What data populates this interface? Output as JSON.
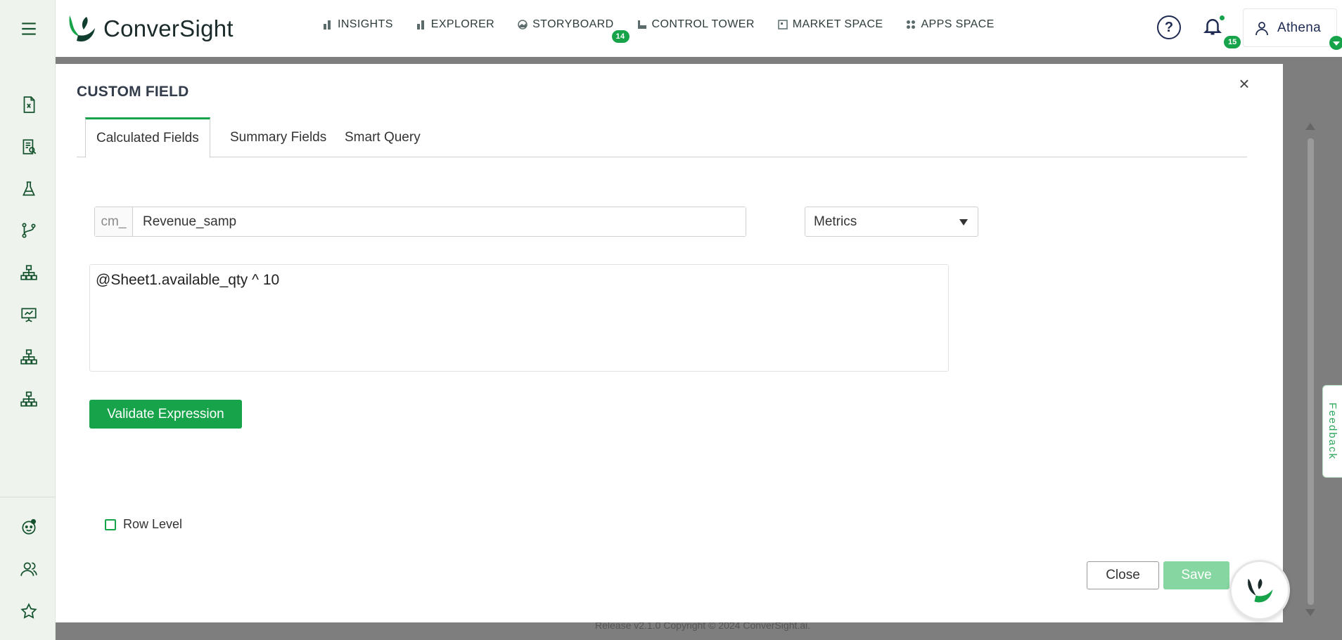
{
  "app": {
    "logo_text": "ConverSight"
  },
  "nav": {
    "items": [
      {
        "label": "INSIGHTS",
        "icon": "bar-chart-icon"
      },
      {
        "label": "EXPLORER",
        "icon": "bar-chart-icon"
      },
      {
        "label": "STORYBOARD",
        "icon": "storyboard-icon",
        "badge": "14"
      },
      {
        "label": "CONTROL TOWER",
        "icon": "tower-icon"
      },
      {
        "label": "MARKET SPACE",
        "icon": "market-icon"
      },
      {
        "label": "APPS SPACE",
        "icon": "apps-icon"
      }
    ],
    "help_symbol": "?",
    "notifications_count": "15",
    "user_name": "Athena"
  },
  "sidebar": {
    "items": [
      "excel-file-icon",
      "report-icon",
      "flask-icon",
      "branch-icon",
      "hierarchy-icon",
      "presentation-icon",
      "hierarchy-icon",
      "hierarchy-icon",
      "assistant-icon",
      "users-icon",
      "star-icon"
    ]
  },
  "modal": {
    "title": "CUSTOM FIELD",
    "close_symbol": "×",
    "tabs": [
      {
        "label": "Calculated Fields",
        "active": true
      },
      {
        "label": "Summary Fields",
        "active": false
      },
      {
        "label": "Smart Query",
        "active": false
      }
    ],
    "field_prefix": "cm_",
    "field_name": "Revenue_samp",
    "field_type": "Metrics",
    "expression": "@Sheet1.available_qty ^ 10",
    "validate_label": "Validate Expression",
    "row_level_label": "Row Level",
    "close_label": "Close",
    "save_label": "Save"
  },
  "footer": {
    "text": "Release v2.1.0 Copyright © 2024 ConverSight.ai."
  },
  "feedback_label": "Feedback",
  "colors": {
    "accent": "#16a34a",
    "save_disabled": "#86d6a2",
    "navy": "#1e2a52"
  }
}
